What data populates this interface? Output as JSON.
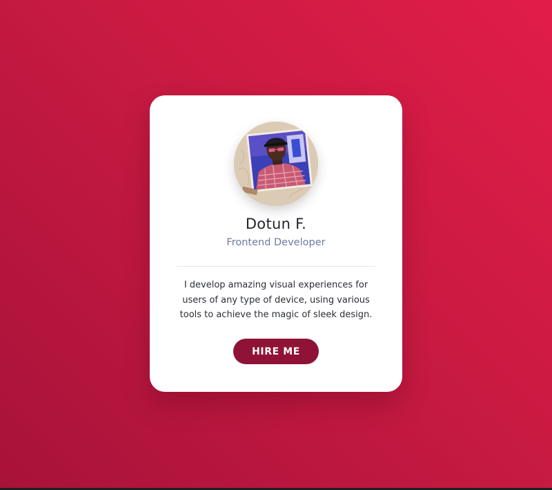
{
  "profile": {
    "name": "Dotun F.",
    "role": "Frontend Developer",
    "bio": "I develop amazing visual experiences for users of any type of device, using various tools to achieve the magic of sleek design.",
    "avatar_icon": "profile-photo"
  },
  "actions": {
    "hire_label": "HIRE ME"
  },
  "colors": {
    "background_start": "#e11d48",
    "background_end": "#a8123a",
    "card": "#ffffff",
    "button": "#8f1237",
    "role_text": "#6b7aa0"
  }
}
